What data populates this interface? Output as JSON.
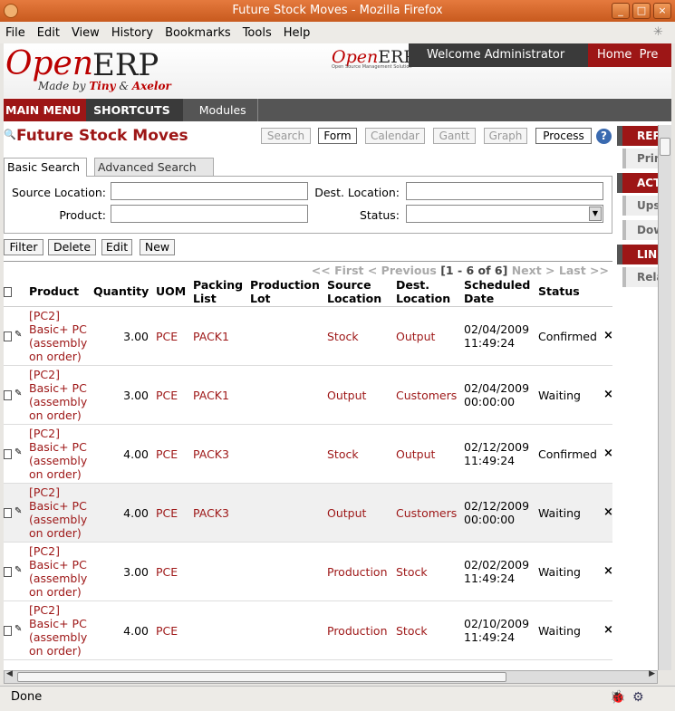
{
  "window": {
    "title": "Future Stock Moves - Mozilla Firefox"
  },
  "menu": [
    "File",
    "Edit",
    "View",
    "History",
    "Bookmarks",
    "Tools",
    "Help"
  ],
  "logo": {
    "open": "Open",
    "erp": "ERP",
    "made_prefix": "Made by ",
    "tiny": "Tiny",
    "amp": " & ",
    "axelor": "Axelor",
    "small_open": "Open",
    "small_erp": "ERP",
    "small_tag": "Open Source Management Solution"
  },
  "header": {
    "welcome": "Welcome Administrator",
    "home": "Home",
    "prefs": "Pre"
  },
  "nav": {
    "main_menu": "MAIN MENU",
    "shortcuts": "SHORTCUTS",
    "modules": "Modules"
  },
  "page": {
    "title": "Future Stock Moves"
  },
  "views": {
    "search": "Search",
    "form": "Form",
    "calendar": "Calendar",
    "gantt": "Gantt",
    "graph": "Graph",
    "process": "Process"
  },
  "tabs": {
    "basic": "Basic Search",
    "advanced": "Advanced Search"
  },
  "search": {
    "source_location": "Source Location:",
    "dest_location": "Dest. Location:",
    "product": "Product:",
    "status": "Status:"
  },
  "actions": {
    "filter": "Filter",
    "delete": "Delete",
    "edit": "Edit",
    "new": "New"
  },
  "pager": {
    "first": "<< First",
    "previous": "< Previous",
    "range": "[1 - 6 of 6]",
    "next": "Next >",
    "last": "Last >>"
  },
  "columns": [
    "Product",
    "Quantity",
    "UOM",
    "Packing List",
    "Production Lot",
    "Source Location",
    "Dest. Location",
    "Scheduled Date",
    "Status"
  ],
  "rows": [
    {
      "product": "[PC2] Basic+ PC (assembly on order)",
      "qty": "3.00",
      "uom": "PCE",
      "packing": "PACK1",
      "lot": "",
      "source": "Stock",
      "dest": "Output",
      "date": "02/04/2009 11:49:24",
      "status": "Confirmed"
    },
    {
      "product": "[PC2] Basic+ PC (assembly on order)",
      "qty": "3.00",
      "uom": "PCE",
      "packing": "PACK1",
      "lot": "",
      "source": "Output",
      "dest": "Customers",
      "date": "02/04/2009 00:00:00",
      "status": "Waiting"
    },
    {
      "product": "[PC2] Basic+ PC (assembly on order)",
      "qty": "4.00",
      "uom": "PCE",
      "packing": "PACK3",
      "lot": "",
      "source": "Stock",
      "dest": "Output",
      "date": "02/12/2009 11:49:24",
      "status": "Confirmed"
    },
    {
      "product": "[PC2] Basic+ PC (assembly on order)",
      "qty": "4.00",
      "uom": "PCE",
      "packing": "PACK3",
      "lot": "",
      "source": "Output",
      "dest": "Customers",
      "date": "02/12/2009 00:00:00",
      "status": "Waiting"
    },
    {
      "product": "[PC2] Basic+ PC (assembly on order)",
      "qty": "3.00",
      "uom": "PCE",
      "packing": "",
      "lot": "",
      "source": "Production",
      "dest": "Stock",
      "date": "02/02/2009 11:49:24",
      "status": "Waiting"
    },
    {
      "product": "[PC2] Basic+ PC (assembly on order)",
      "qty": "4.00",
      "uom": "PCE",
      "packing": "",
      "lot": "",
      "source": "Production",
      "dest": "Stock",
      "date": "02/10/2009 11:49:24",
      "status": "Waiting"
    }
  ],
  "sidebar": {
    "reports": "REP",
    "print": "Print",
    "actions": "ACT",
    "upstream": "Upst",
    "downstream": "Dow",
    "links": "LINK",
    "related": "Rela"
  },
  "status": {
    "text": "Done"
  }
}
